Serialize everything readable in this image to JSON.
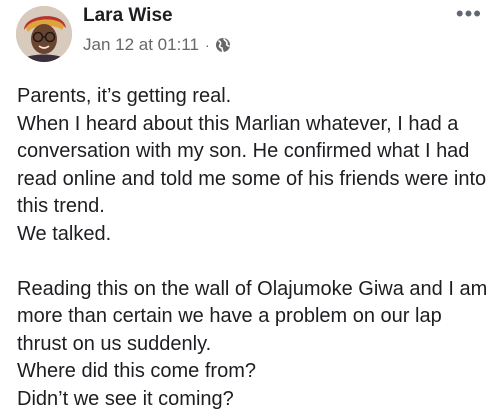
{
  "post": {
    "author_name": "Lara Wise",
    "timestamp": "Jan 12 at 01:11",
    "separator": "·",
    "privacy_icon": "globe-icon",
    "more_icon": "more-options-icon",
    "more_glyph": "•••",
    "paragraphs": [
      "Parents, it’s getting real.\nWhen I heard about this Marlian whatever, I had a conversation with my son. He confirmed what I had read online and told me some of his friends were into this trend.\nWe talked.",
      "Reading this on the wall of Olajumoke Giwa and I am more than certain we have a problem on our lap thrust on us suddenly.\nWhere did this come from?\nDidn’t we see it coming?"
    ]
  },
  "colors": {
    "text_primary": "#1c1e21",
    "text_secondary": "#65676b",
    "background": "#ffffff"
  }
}
